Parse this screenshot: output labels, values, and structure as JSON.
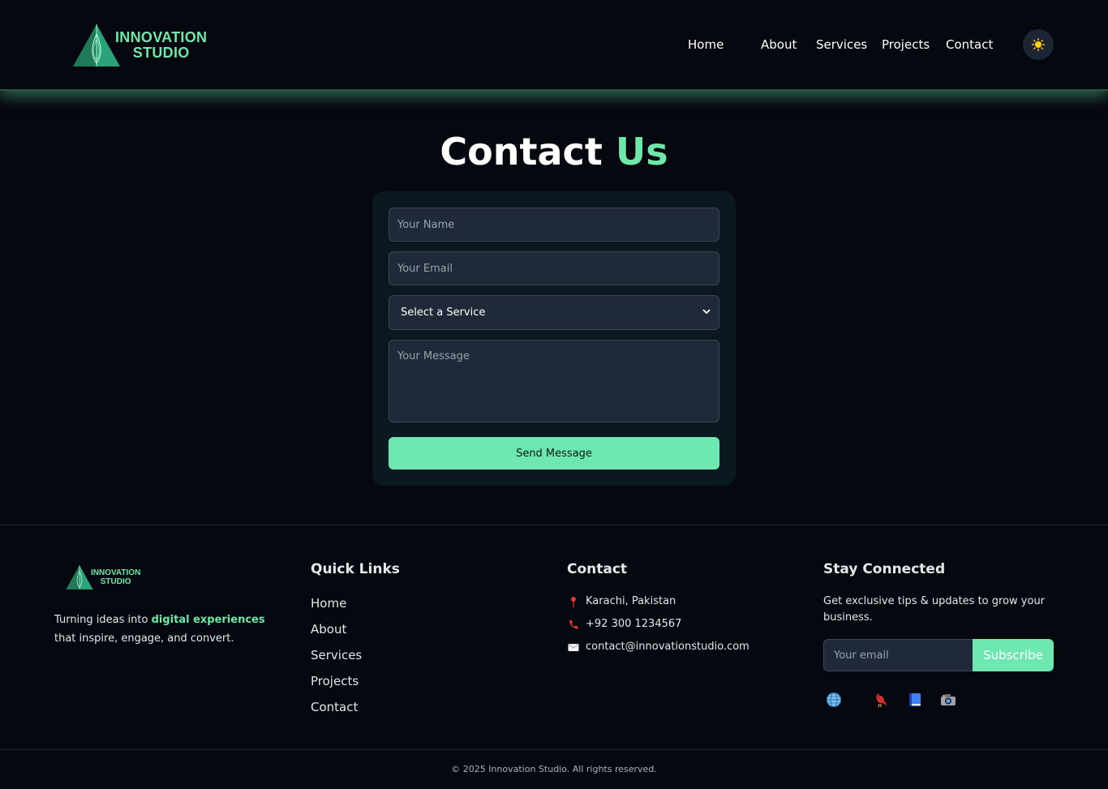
{
  "brand": {
    "line1": "INNOVATION",
    "line2": "STUDIO",
    "accent": "#6ee7a8"
  },
  "nav": {
    "items": [
      "Home",
      "About",
      "Services",
      "Projects",
      "Contact"
    ]
  },
  "theme_toggle": {
    "icon": "sun-icon"
  },
  "page": {
    "title_main": "Contact",
    "title_accent": "Us"
  },
  "form": {
    "name_placeholder": "Your Name",
    "email_placeholder": "Your Email",
    "service_selected": "Select a Service",
    "message_placeholder": "Your Message",
    "send_label": "Send Message"
  },
  "footer": {
    "tagline_before": "Turning ideas into ",
    "tagline_highlight": "digital experiences",
    "tagline_after": " that inspire, engage, and convert.",
    "quick_links_title": "Quick Links",
    "quick_links": [
      "Home",
      "About",
      "Services",
      "Projects",
      "Contact"
    ],
    "contact_title": "Contact",
    "contact_items": [
      {
        "icon": "pin-icon",
        "text": "Karachi, Pakistan"
      },
      {
        "icon": "phone-icon",
        "text": "+92 300 1234567"
      },
      {
        "icon": "mail-icon",
        "text": "contact@innovationstudio.com"
      }
    ],
    "stay_title": "Stay Connected",
    "stay_text": "Get exclusive tips & updates to grow your business.",
    "email_placeholder": "Your email",
    "subscribe_label": "Subscribe",
    "social_icons": [
      "globe-icon",
      "bird-icon",
      "book-icon",
      "camera-icon"
    ],
    "copyright": "© 2025 Innovation Studio. All rights reserved."
  }
}
